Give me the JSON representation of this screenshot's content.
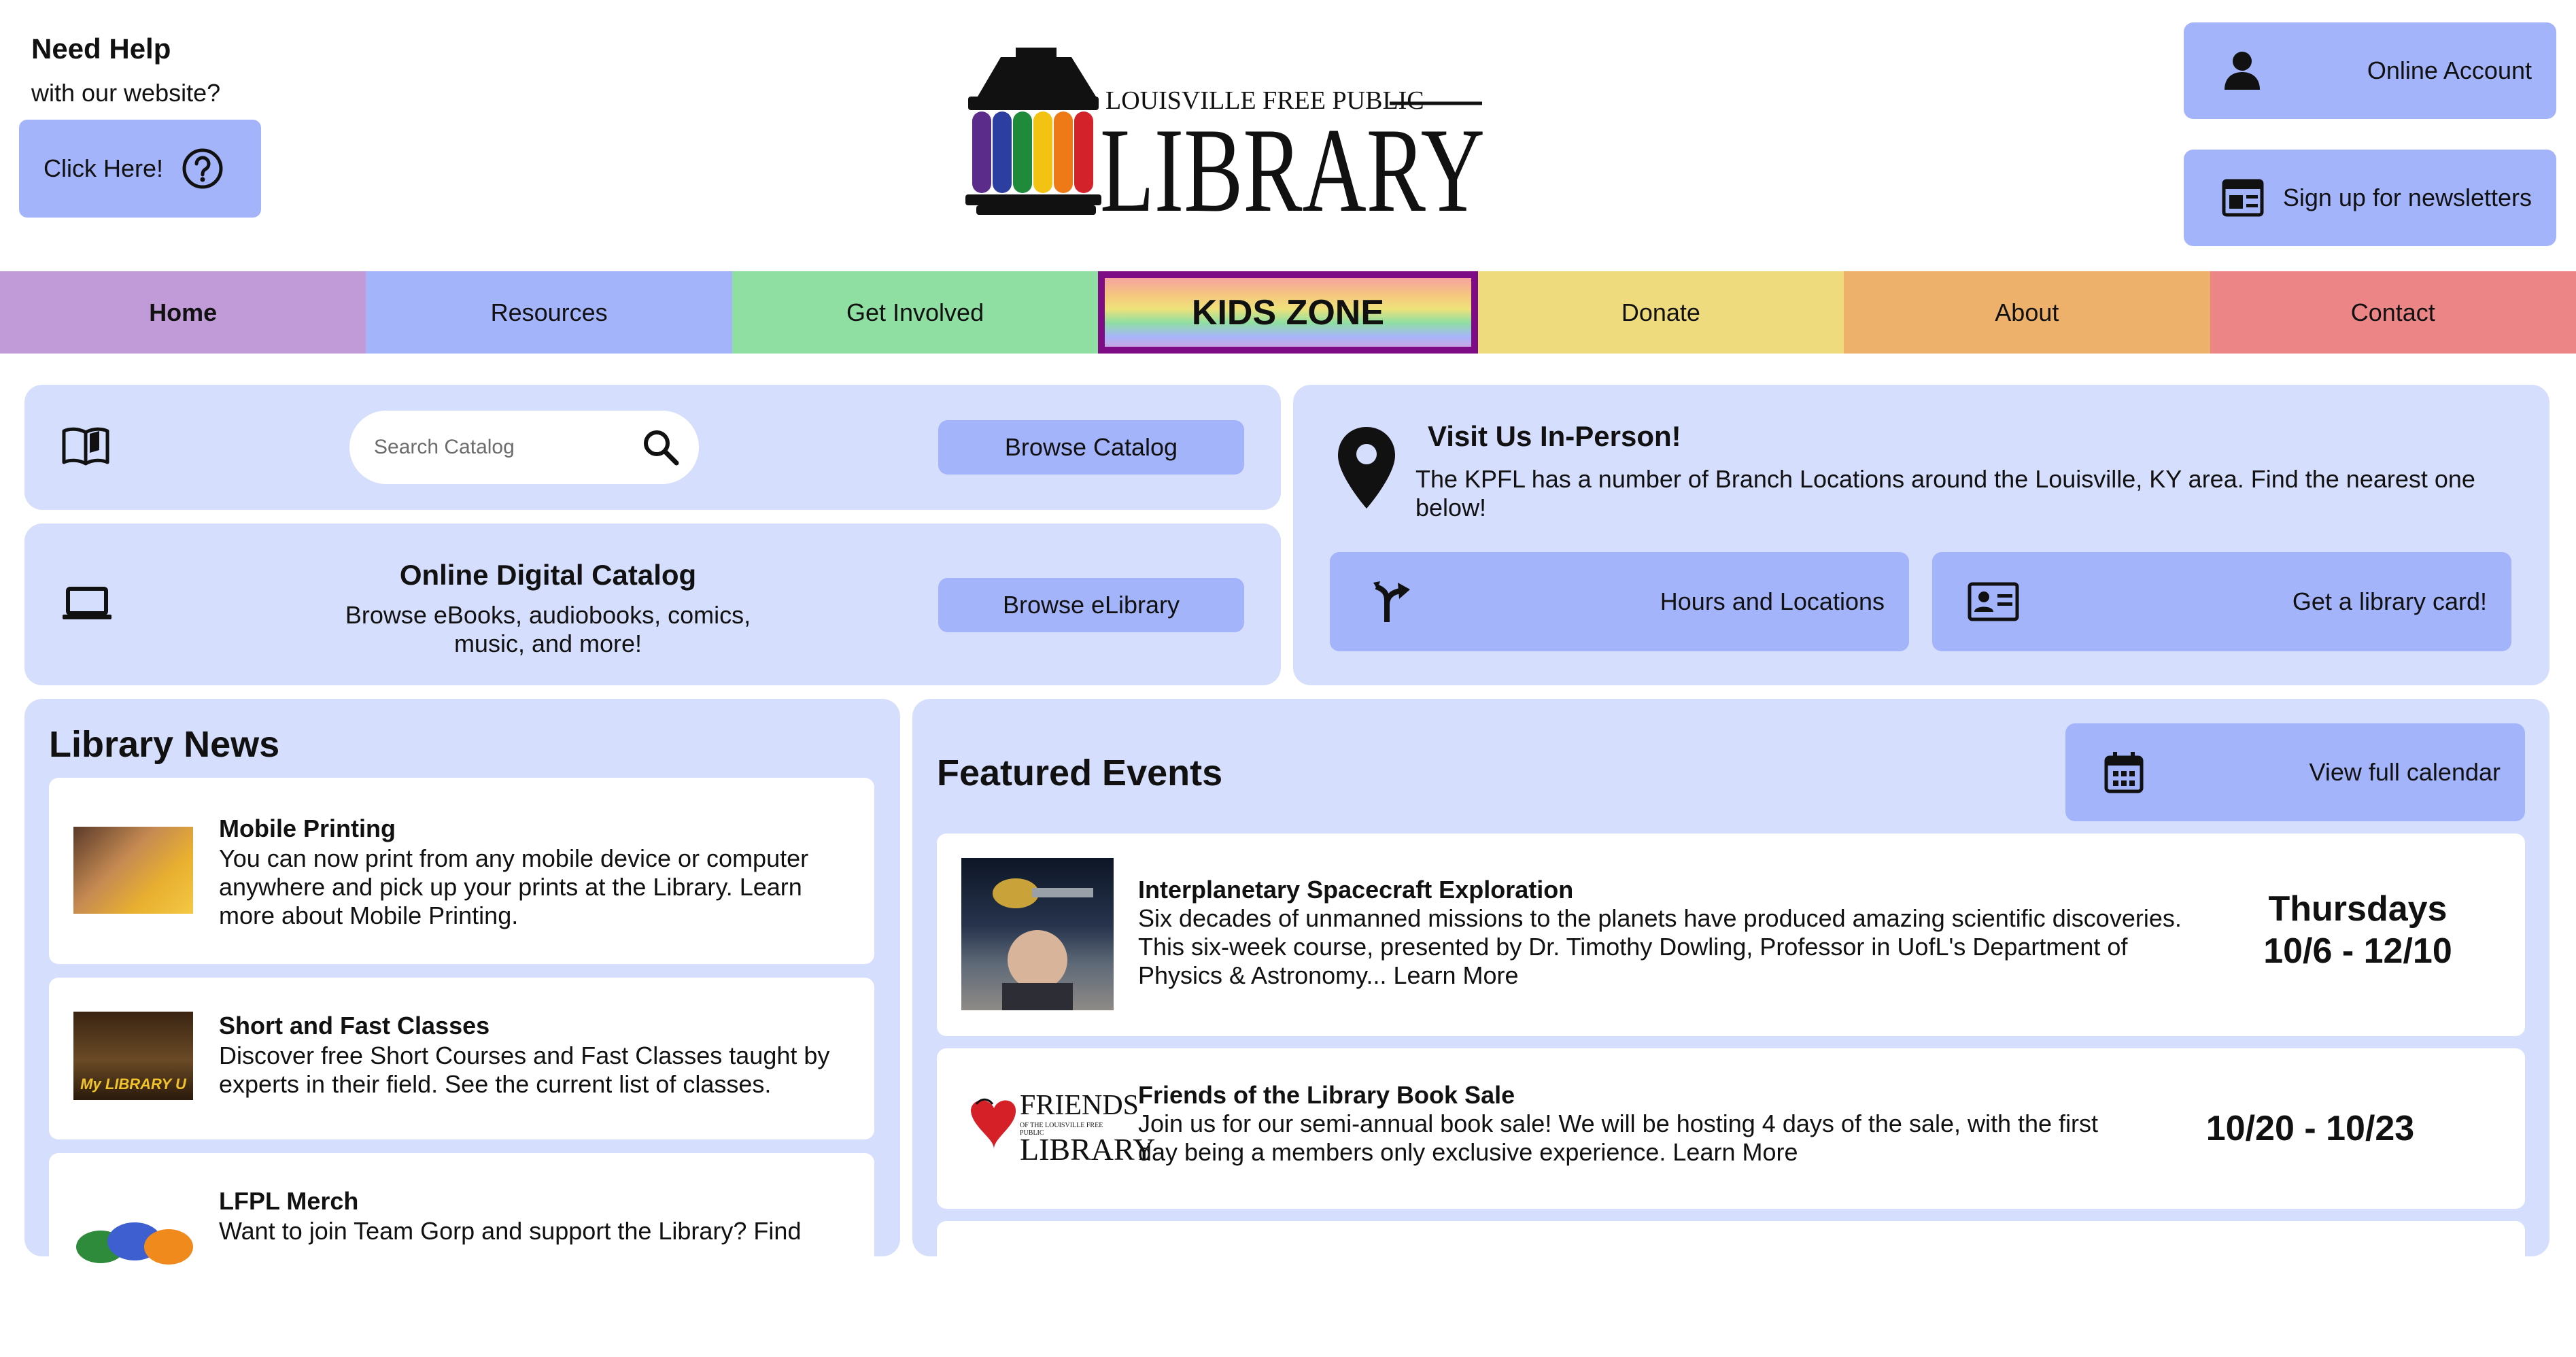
{
  "help": {
    "title": "Need Help",
    "subtitle": "with our website?",
    "button_label": "Click Here!"
  },
  "logo": {
    "line1": "LOUISVILLE FREE PUBLIC",
    "line2": "LIBRARY"
  },
  "account": {
    "online_account_label": "Online Account",
    "newsletter_label": "Sign up for newsletters"
  },
  "nav": {
    "items": [
      {
        "label": "Home",
        "color": "#c09bd8"
      },
      {
        "label": "Resources",
        "color": "#a4b4fb"
      },
      {
        "label": "Get Involved",
        "color": "#8fdfa2"
      },
      {
        "label": "KIDS ZONE",
        "color": "#7e0d85"
      },
      {
        "label": "Donate",
        "color": "#eedb7e"
      },
      {
        "label": "About",
        "color": "#eeb16b"
      },
      {
        "label": "Contact",
        "color": "#ec8585"
      }
    ]
  },
  "catalog": {
    "search_placeholder": "Search Catalog",
    "browse_catalog_label": "Browse Catalog",
    "digital_title": "Online Digital Catalog",
    "digital_desc": "Browse eBooks, audiobooks, comics, music, and more!",
    "browse_elibrary_label": "Browse eLibrary"
  },
  "visit": {
    "title": "Visit Us In-Person!",
    "desc": "The KPFL has a number of Branch Locations around the Louisville, KY area. Find the nearest one below!",
    "hours_label": "Hours and Locations",
    "card_label": "Get a library card!"
  },
  "news": {
    "title": "Library News",
    "items": [
      {
        "title": "Mobile Printing",
        "desc": "You can now print from any mobile device or computer anywhere and pick up your prints at the Library. Learn more about Mobile Printing."
      },
      {
        "title": "Short and Fast Classes",
        "desc": "Discover free Short Courses and Fast Classes taught by experts in their field. See the current list of classes.",
        "image_text": "My LIBRARY U"
      },
      {
        "title": "LFPL Merch",
        "desc": "Want to join Team Gorp and support the Library? Find"
      }
    ]
  },
  "events": {
    "title": "Featured Events",
    "calendar_label": "View full calendar",
    "items": [
      {
        "title": "Interplanetary Spacecraft Exploration",
        "desc": "Six decades of unmanned missions to the planets have produced amazing scientific discoveries. This six-week course, presented by Dr. Timothy Dowling, Professor in UofL's Department of Physics & Astronomy... Learn More",
        "date_line1": "Thursdays",
        "date_line2": "10/6 - 12/10"
      },
      {
        "title": "Friends of the Library Book Sale",
        "desc": "Join us for our semi-annual book sale! We will be hosting 4 days of the sale, with the first day being a members only exclusive experience. Learn More",
        "date_line1": "10/20 - 10/23",
        "logo_line1": "FRIENDS",
        "logo_line2": "OF THE LOUISVILLE FREE PUBLIC",
        "logo_line3": "LIBRARY"
      }
    ]
  },
  "colors": {
    "panel_bg": "#d6defe",
    "button_bg": "#a4b4fb",
    "kids_border": "#7e0d85"
  }
}
